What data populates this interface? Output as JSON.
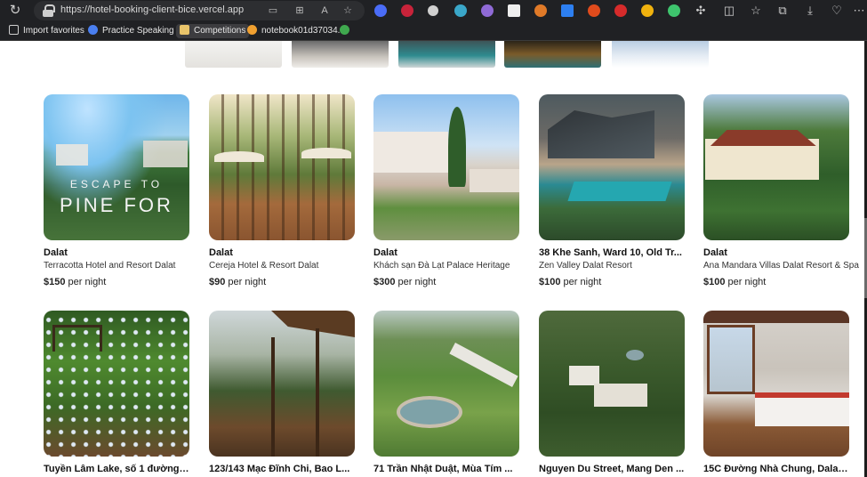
{
  "browser": {
    "url": "https://hotel-booking-client-bice.vercel.app",
    "bookmarks": [
      {
        "label": "Import favorites"
      },
      {
        "label": "Practice Speaking E..."
      },
      {
        "label": "Competitions"
      },
      {
        "label": "notebook01d37034..."
      }
    ]
  },
  "colors": {
    "chrome_bg": "#202124",
    "accent": "#222222"
  },
  "listings": [
    {
      "location": "Dalat",
      "name": "Terracotta Hotel and Resort Dalat",
      "price": "$150",
      "unit": "per night",
      "overlay_line1": "ESCAPE TO",
      "overlay_line2": "PINE FOR"
    },
    {
      "location": "Dalat",
      "name": "Cereja Hotel & Resort Dalat",
      "price": "$90",
      "unit": "per night"
    },
    {
      "location": "Dalat",
      "name": "Khách sạn Đà Lạt Palace Heritage",
      "price": "$300",
      "unit": "per night"
    },
    {
      "location": "38 Khe Sanh, Ward 10, Old Tr...",
      "name": "Zen Valley Dalat Resort",
      "price": "$100",
      "unit": "per night"
    },
    {
      "location": "Dalat",
      "name": "Ana Mandara Villas Dalat Resort & Spa",
      "price": "$100",
      "unit": "per night"
    },
    {
      "location": "Tuyền Lâm Lake, số 1 đường ..."
    },
    {
      "location": "123/143 Mạc Đĩnh Chi, Bao L..."
    },
    {
      "location": "71 Trần Nhật Duật, Mùa Tím ..."
    },
    {
      "location": "Nguyen Du Street, Mang Den ..."
    },
    {
      "location": "15C Đường Nhà Chung, Dalat..."
    }
  ]
}
